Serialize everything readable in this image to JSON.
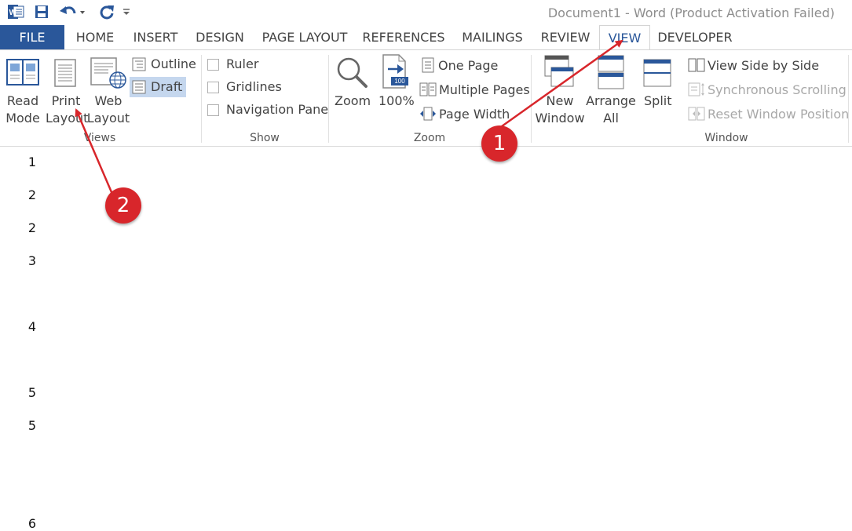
{
  "title_bar": {
    "document_title": "Document1 - Word (Product Activation Failed)",
    "quick_access": [
      "word-app-icon",
      "save-icon",
      "undo-icon",
      "redo-icon",
      "customize-qat-icon"
    ]
  },
  "tabs": [
    {
      "label": "FILE"
    },
    {
      "label": "HOME"
    },
    {
      "label": "INSERT"
    },
    {
      "label": "DESIGN"
    },
    {
      "label": "PAGE LAYOUT"
    },
    {
      "label": "REFERENCES"
    },
    {
      "label": "MAILINGS"
    },
    {
      "label": "REVIEW"
    },
    {
      "label": "VIEW"
    },
    {
      "label": "DEVELOPER"
    }
  ],
  "ribbon": {
    "views": {
      "group_label": "Views",
      "read_mode": [
        "Read",
        "Mode"
      ],
      "print_layout": [
        "Print",
        "Layout"
      ],
      "web_layout": [
        "Web",
        "Layout"
      ],
      "outline": "Outline",
      "draft": "Draft"
    },
    "show": {
      "group_label": "Show",
      "ruler": "Ruler",
      "gridlines": "Gridlines",
      "navigation_pane": "Navigation Pane"
    },
    "zoom": {
      "group_label": "Zoom",
      "zoom": "Zoom",
      "hundred": "100%",
      "hundred_badge": "100",
      "one_page": "One Page",
      "multiple_pages": "Multiple Pages",
      "page_width": "Page Width"
    },
    "window": {
      "group_label": "Window",
      "new_window": [
        "New",
        "Window"
      ],
      "arrange_all": [
        "Arrange",
        "All"
      ],
      "split": "Split",
      "view_side_by_side": "View Side by Side",
      "synchronous_scrolling": "Synchronous Scrolling",
      "reset_window_position": "Reset Window Position"
    }
  },
  "document": {
    "lines": [
      "1",
      "2",
      "2",
      "3",
      "4",
      "5",
      "5",
      "6"
    ]
  },
  "annotations": {
    "badge_1": "1",
    "badge_2": "2",
    "color": "#d8262b"
  },
  "colors": {
    "accent": "#2a579a",
    "selected_button_bg": "#c5d7ee"
  }
}
